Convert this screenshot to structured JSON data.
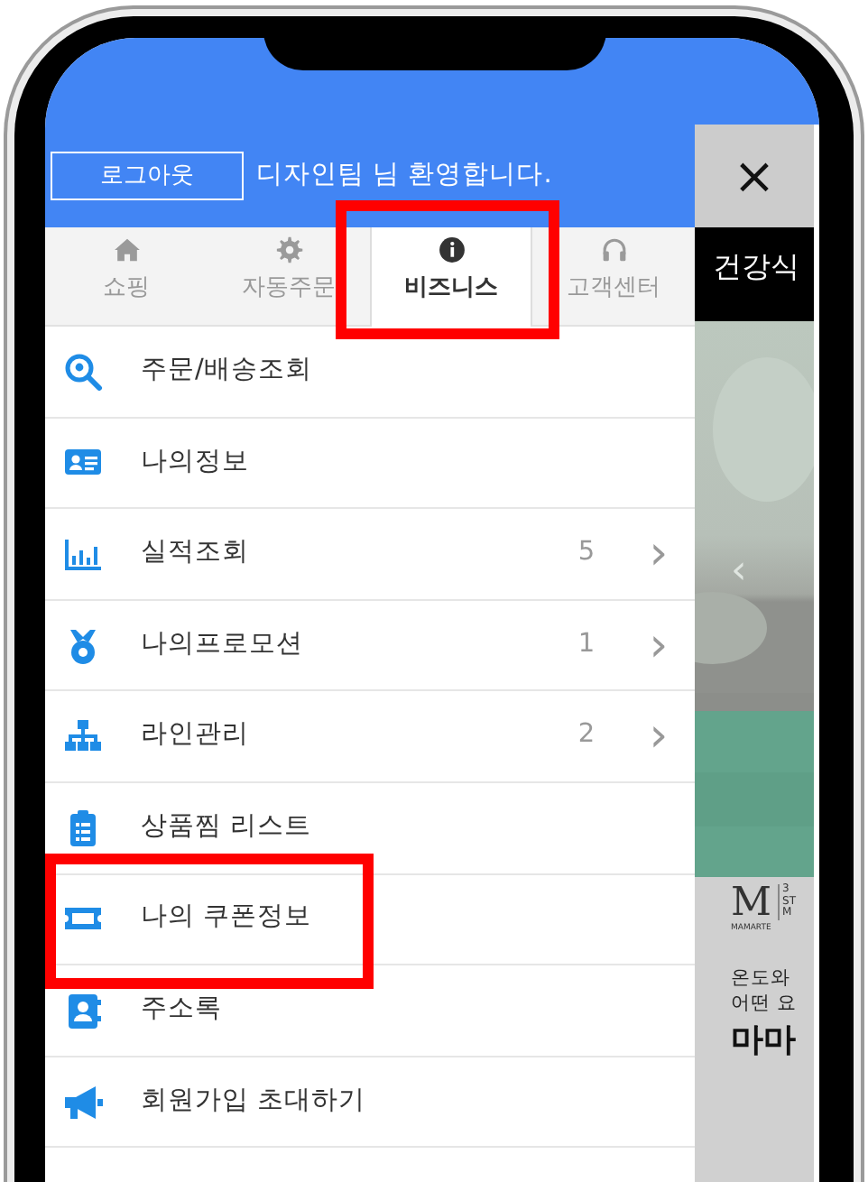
{
  "header": {
    "logout_button": "로그아웃",
    "greeting": "디자인팀 님 환영합니다."
  },
  "tabs": [
    {
      "label": "쇼핑",
      "kind": "home",
      "selected": false,
      "highlighted": false
    },
    {
      "label": "자동주문",
      "kind": "gear",
      "selected": false,
      "highlighted": false
    },
    {
      "label": "비즈니스",
      "kind": "info",
      "selected": true,
      "highlighted": true
    },
    {
      "label": "고객센터",
      "kind": "headset",
      "selected": false,
      "highlighted": false
    }
  ],
  "menu": [
    {
      "label": "주문/배송조회",
      "kind": "search-pin",
      "highlighted": false
    },
    {
      "label": "나의정보",
      "kind": "id-card",
      "highlighted": false
    },
    {
      "label": "실적조회",
      "kind": "chart",
      "count": "5",
      "chevron": "›",
      "highlighted": false
    },
    {
      "label": "나의프로모션",
      "kind": "medal",
      "count": "1",
      "chevron": "›",
      "highlighted": false
    },
    {
      "label": "라인관리",
      "kind": "tree",
      "count": "2",
      "chevron": "›",
      "highlighted": false
    },
    {
      "label": "상품찜 리스트",
      "kind": "clipboard",
      "highlighted": false
    },
    {
      "label": "나의 쿠폰정보",
      "kind": "ticket",
      "highlighted": true
    },
    {
      "label": "주소록",
      "kind": "contact",
      "highlighted": false
    },
    {
      "label": "회원가입 초대하기",
      "kind": "megaphone",
      "highlighted": false
    }
  ],
  "side_page": {
    "close": "×",
    "banner": "건강식",
    "carousel_prev": "‹",
    "logo_mark": "M",
    "logo_text": "MAMARTE",
    "logo_side": [
      "3",
      "ST",
      "M"
    ],
    "lines": [
      "온도와",
      "어떤 요"
    ],
    "headline": "마마"
  }
}
